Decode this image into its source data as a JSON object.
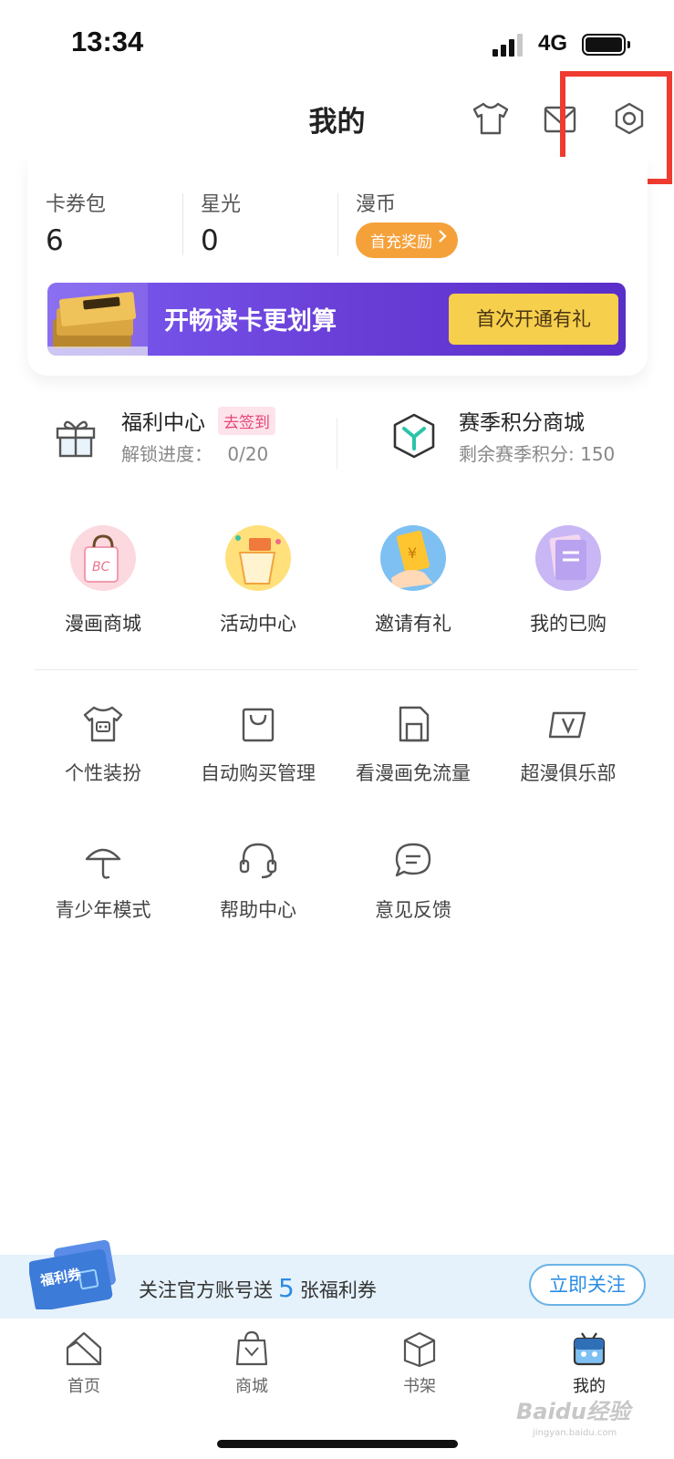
{
  "status_bar": {
    "time": "13:34",
    "network": "4G"
  },
  "header": {
    "title": "我的"
  },
  "wallet": {
    "coupons": {
      "label": "卡券包",
      "value": "6"
    },
    "stars": {
      "label": "星光",
      "value": "0"
    },
    "coins": {
      "label": "漫币",
      "reward_label": "首充奖励"
    }
  },
  "promo_banner": {
    "text": "开畅读卡更划算",
    "cta": "首次开通有礼"
  },
  "welfare": {
    "title": "福利中心",
    "badge": "去签到",
    "progress_label": "解锁进度：",
    "progress_value": "0/20"
  },
  "season": {
    "title": "赛季积分商城",
    "points_text": "剩余赛季积分: 150"
  },
  "features": [
    {
      "label": "漫画商城",
      "icon": "shopping-bag-icon"
    },
    {
      "label": "活动中心",
      "icon": "party-popper-icon"
    },
    {
      "label": "邀请有礼",
      "icon": "red-envelope-icon"
    },
    {
      "label": "我的已购",
      "icon": "purchased-books-icon"
    }
  ],
  "tools": [
    {
      "label": "个性装扮",
      "icon": "robot-shirt-icon"
    },
    {
      "label": "自动购买管理",
      "icon": "bag-icon"
    },
    {
      "label": "看漫画免流量",
      "icon": "sim-card-icon"
    },
    {
      "label": "超漫俱乐部",
      "icon": "v-club-icon"
    },
    {
      "label": "青少年模式",
      "icon": "umbrella-icon"
    },
    {
      "label": "帮助中心",
      "icon": "headset-icon"
    },
    {
      "label": "意见反馈",
      "icon": "feedback-bubble-icon"
    }
  ],
  "follow_bar": {
    "coupon_label": "福利券",
    "text_before": "关注官方账号送",
    "count": "5",
    "text_after": "张福利券",
    "button": "立即关注"
  },
  "tabs": [
    {
      "label": "首页",
      "icon": "home-icon"
    },
    {
      "label": "商城",
      "icon": "mall-bag-icon"
    },
    {
      "label": "书架",
      "icon": "bookshelf-icon"
    },
    {
      "label": "我的",
      "icon": "mine-robot-icon",
      "active": true
    }
  ],
  "watermark": {
    "text": "Baidu经验",
    "sub": "jingyan.baidu.com"
  },
  "colors": {
    "accent_blue": "#2b8de3",
    "reward_orange": "#f5a13a",
    "promo_purple": "#6a3fd8",
    "promo_gold": "#f6cf4c",
    "highlight_red": "#f03b30"
  }
}
